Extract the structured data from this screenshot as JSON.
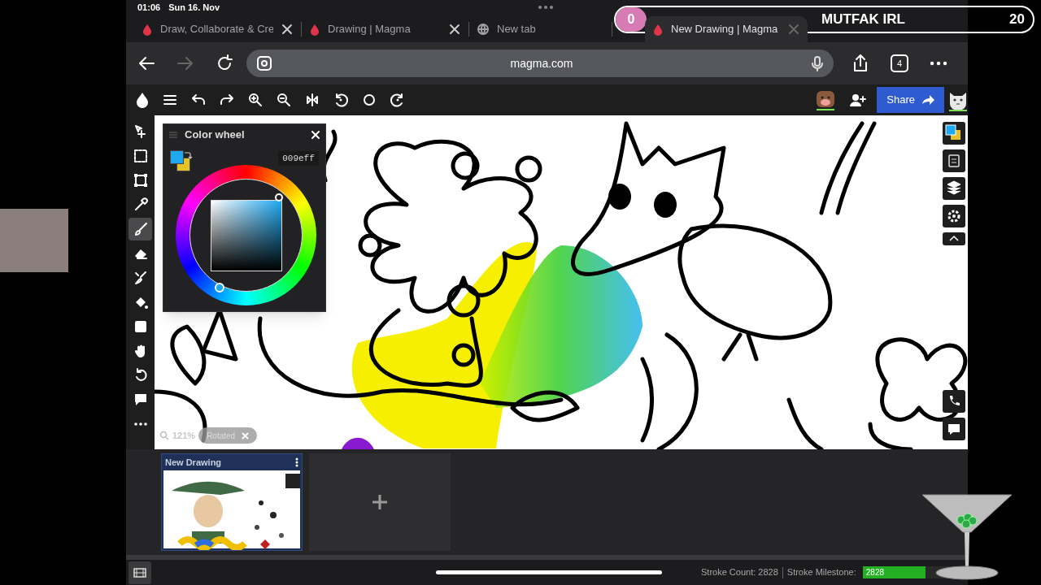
{
  "status_bar": {
    "time": "01:06",
    "date": "Sun 16. Nov"
  },
  "browser": {
    "tabs": [
      {
        "title": "Draw, Collaborate & Cre",
        "kind": "magma",
        "closable": true,
        "selected": false
      },
      {
        "title": "Drawing | Magma",
        "kind": "magma",
        "closable": true,
        "selected": false
      },
      {
        "title": "New tab",
        "kind": "globe",
        "closable": false,
        "selected": false
      },
      {
        "title": "New Drawing | Magma",
        "kind": "magma",
        "closable": true,
        "selected": true
      }
    ],
    "forward_disabled": true,
    "address": "magma.com",
    "tab_count": "4"
  },
  "app": {
    "share_label": "Share",
    "tools": [
      {
        "kind": "move",
        "selected": false
      },
      {
        "kind": "marquee",
        "selected": false
      },
      {
        "kind": "transform",
        "selected": false
      },
      {
        "kind": "eyedropper",
        "selected": false
      },
      {
        "kind": "brush",
        "selected": true
      },
      {
        "kind": "eraser",
        "selected": false
      },
      {
        "kind": "smudge",
        "selected": false
      },
      {
        "kind": "fill",
        "selected": false
      },
      {
        "kind": "shape",
        "selected": false
      },
      {
        "kind": "hand",
        "selected": false
      },
      {
        "kind": "rotate",
        "selected": false
      },
      {
        "kind": "comment",
        "selected": false
      },
      {
        "kind": "more",
        "selected": false
      }
    ],
    "color_wheel": {
      "title": "Color wheel",
      "hex": "009eff",
      "swatches": [
        {
          "color": "#1ea8f0"
        },
        {
          "color": "#e6c229"
        }
      ]
    },
    "view": {
      "zoom": "121%",
      "rotation": "Rotated"
    },
    "drawings": [
      {
        "title": "New Drawing"
      }
    ],
    "status": {
      "stroke_count": "Stroke Count: 2828",
      "milestone_label": "Stroke Milestone:",
      "milestone_value": "2828",
      "level": 0.62
    }
  },
  "stream_overlay": {
    "left_count": "0",
    "title": "MUTFAK IRL",
    "right_count": "20"
  }
}
